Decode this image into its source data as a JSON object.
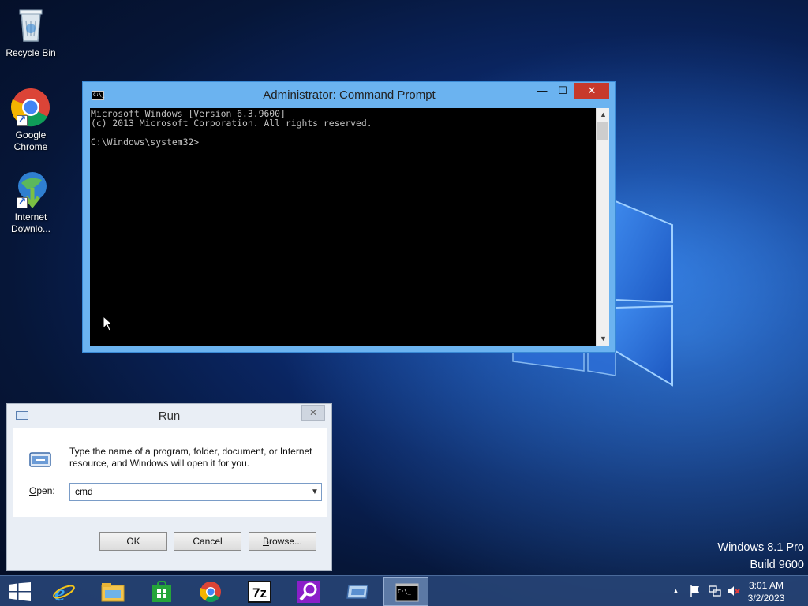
{
  "desktop": {
    "icons": [
      {
        "label": "Recycle Bin"
      },
      {
        "label": "Google Chrome"
      },
      {
        "label": "Internet Downlo..."
      }
    ],
    "watermark": {
      "line1": "Windows 8.1 Pro",
      "line2": "Build 9600"
    }
  },
  "cmd_window": {
    "title": "Administrator: Command Prompt",
    "icon_text": "C:\\_",
    "close_glyph": "✕",
    "min_glyph": "—",
    "max_glyph": "☐",
    "lines": [
      "Microsoft Windows [Version 6.3.9600]",
      "(c) 2013 Microsoft Corporation. All rights reserved.",
      "",
      "C:\\Windows\\system32>"
    ]
  },
  "run_dialog": {
    "title": "Run",
    "close_glyph": "✕",
    "description": "Type the name of a program, folder, document, or Internet resource, and Windows will open it for you.",
    "open_label_accel": "O",
    "open_label_rest": "pen:",
    "input_value": "cmd",
    "ok_label": "OK",
    "cancel_label": "Cancel",
    "browse_label_accel": "B",
    "browse_label_rest": "rowse..."
  },
  "taskbar": {
    "items": [
      {
        "name": "start-button"
      },
      {
        "name": "internet-explorer"
      },
      {
        "name": "file-explorer"
      },
      {
        "name": "store"
      },
      {
        "name": "google-chrome"
      },
      {
        "name": "7-zip",
        "label": "7z"
      },
      {
        "name": "search-app"
      },
      {
        "name": "run-app"
      },
      {
        "name": "command-prompt",
        "label": "C:\\_"
      }
    ],
    "clock": {
      "time": "3:01 AM",
      "date": "3/2/2023"
    }
  },
  "colors": {
    "accent": "#6bb3f0",
    "close": "#c7392b",
    "taskbar": "#284678"
  }
}
